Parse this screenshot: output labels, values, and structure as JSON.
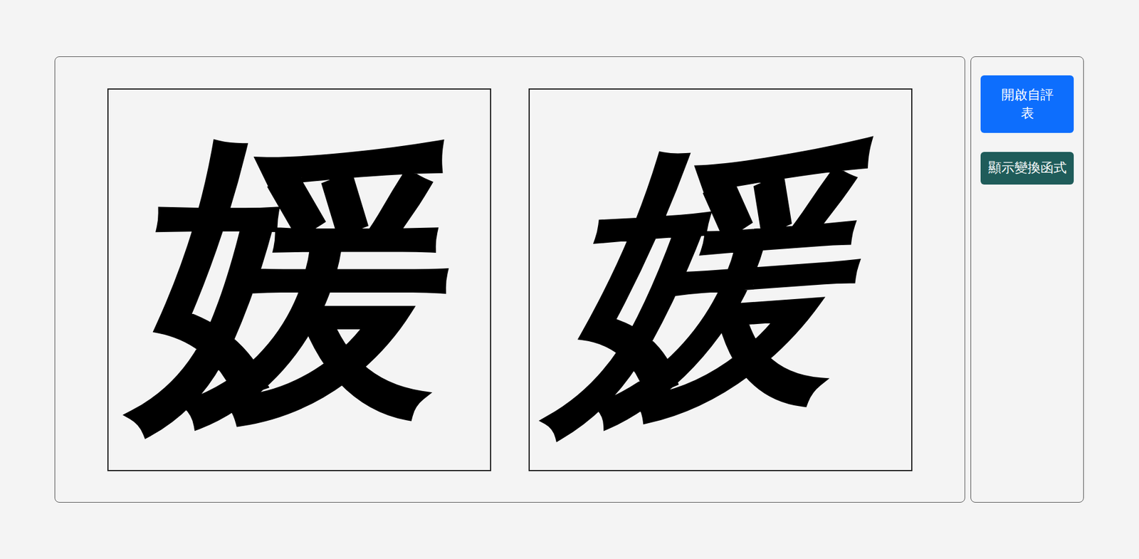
{
  "canvases": [
    {
      "character": "媛",
      "distorted": false
    },
    {
      "character": "媛",
      "distorted": true
    }
  ],
  "buttons": [
    {
      "label": "開啟自評表",
      "color": "#0d6efd",
      "wide_padding": true
    },
    {
      "label": "顯示變換函式",
      "color": "#1f5c5a",
      "wide_padding": false
    }
  ]
}
